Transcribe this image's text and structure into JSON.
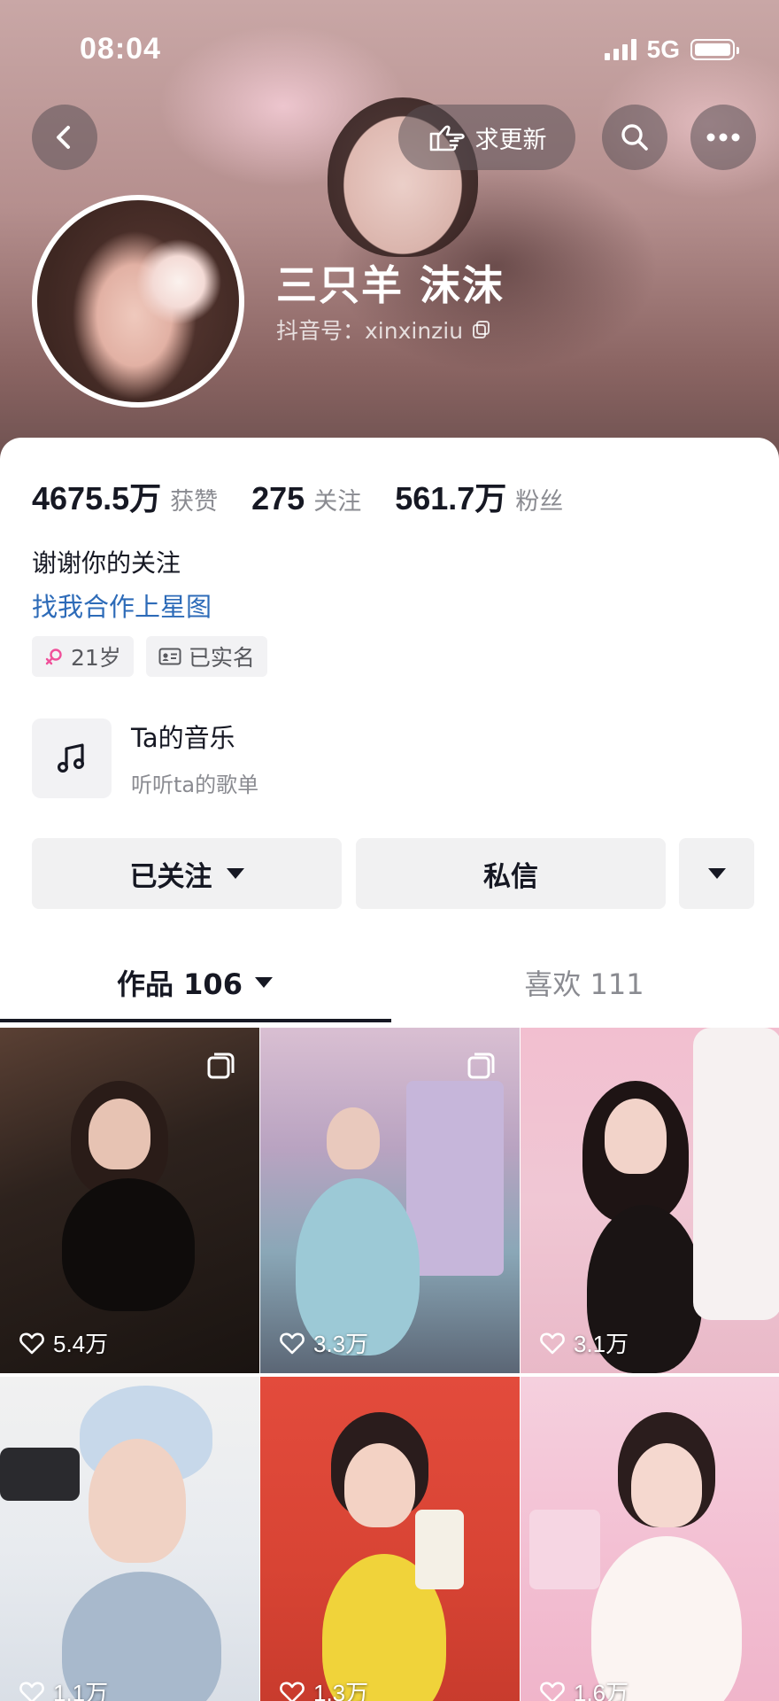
{
  "status_bar": {
    "time": "08:04",
    "network": "5G"
  },
  "header": {
    "request_update_label": "求更新",
    "nickname": "三只羊 沫沫",
    "douyin_id": "抖音号：xinxinziu"
  },
  "stats": [
    {
      "value": "4675.5万",
      "label": "获赞"
    },
    {
      "value": "275",
      "label": "关注"
    },
    {
      "value": "561.7万",
      "label": "粉丝"
    }
  ],
  "bio": "谢谢你的关注",
  "star_link": "找我合作上星图",
  "tags": {
    "age": "21岁",
    "verified": "已实名"
  },
  "music": {
    "title": "Ta的音乐",
    "subtitle": "听听ta的歌单"
  },
  "actions": {
    "followed_label": "已关注",
    "message_label": "私信"
  },
  "tabs": {
    "works_label": "作品 106",
    "likes_label": "喜欢 111"
  },
  "videos": [
    {
      "likes": "5.4万"
    },
    {
      "likes": "3.3万"
    },
    {
      "likes": "3.1万"
    },
    {
      "likes": "1.1万"
    },
    {
      "likes": "1.3万"
    },
    {
      "likes": "1.6万"
    }
  ],
  "colors": {
    "link": "#2d6bb8",
    "text": "#161823",
    "muted": "#8a8b91",
    "button_bg": "#f1f1f2"
  },
  "icons": [
    "back-icon",
    "hand-point-icon",
    "search-icon",
    "more-icon",
    "copy-icon",
    "female-icon",
    "id-card-icon",
    "music-note-icon",
    "heart-icon",
    "multi-image-icon"
  ]
}
